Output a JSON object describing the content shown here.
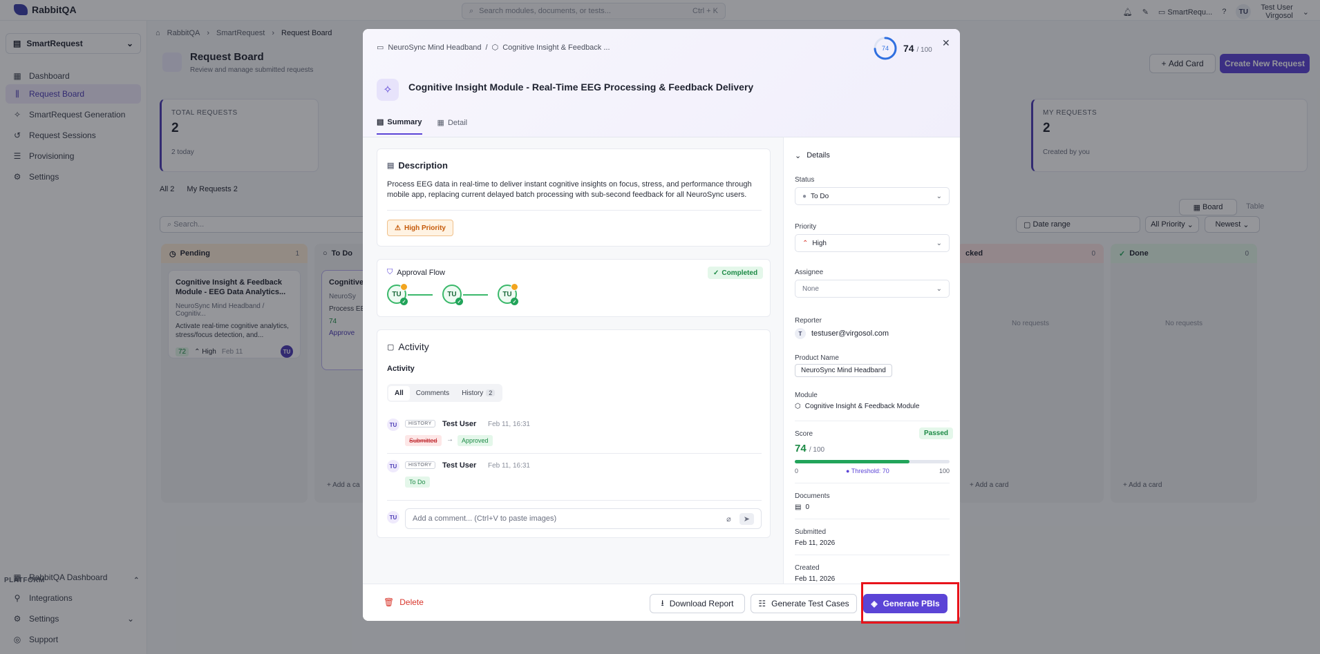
{
  "app": {
    "name": "RabbitQA"
  },
  "topbar": {
    "search_placeholder": "Search modules, documents, or tests...",
    "search_shortcut": "Ctrl + K",
    "workspace": "SmartRequ...",
    "user_initials": "TU",
    "user_name": "Test User",
    "user_org": "Virgosol"
  },
  "sidebar": {
    "workspace": "SmartRequest",
    "items": [
      {
        "label": "Dashboard",
        "icon": "grid-icon"
      },
      {
        "label": "Request Board",
        "icon": "board-icon"
      },
      {
        "label": "SmartRequest Generation",
        "icon": "sparkle-icon"
      },
      {
        "label": "Request Sessions",
        "icon": "history-icon"
      },
      {
        "label": "Provisioning",
        "icon": "sliders-icon"
      },
      {
        "label": "Settings",
        "icon": "gear-icon"
      }
    ],
    "platform_label": "PLATFORM",
    "platform_items": [
      {
        "label": "RabbitQA Dashboard"
      },
      {
        "label": "Integrations"
      },
      {
        "label": "Settings"
      },
      {
        "label": "Support"
      }
    ]
  },
  "page": {
    "breadcrumb": [
      "RabbitQA",
      "SmartRequest",
      "Request Board"
    ],
    "title": "Request Board",
    "subtitle": "Review and manage submitted requests",
    "add_card": "Add Card",
    "create_new": "Create New Request",
    "stats": [
      {
        "label": "TOTAL REQUESTS",
        "value": "2",
        "note": "2 today"
      },
      {
        "label": "MY REQUESTS",
        "value": "2",
        "note": "Created by you"
      }
    ],
    "filters": {
      "all": "All",
      "all_count": "2",
      "mine": "My Requests",
      "mine_count": "2",
      "search": "Search...",
      "date_range": "Date range",
      "priority": "All Priority",
      "sort": "Newest",
      "board": "Board",
      "table": "Table"
    },
    "columns": [
      {
        "name": "Pending",
        "count": "1"
      },
      {
        "name": "To Do",
        "count": ""
      },
      {
        "name": "cked",
        "count": "0",
        "empty": "No requests",
        "add": "Add a card"
      },
      {
        "name": "Done",
        "count": "0",
        "empty": "No requests",
        "add": "Add a card"
      }
    ],
    "card1": {
      "title": "Cognitive Insight & Feedback Module - EEG Data Analytics...",
      "path": "NeuroSync Mind Headband / Cognitiv...",
      "desc": "Activate real-time cognitive analytics, stress/focus detection, and...",
      "score": "72",
      "priority": "High",
      "date": "Feb 11",
      "avatar": "TU"
    },
    "card2": {
      "title": "Cognitive Ir Time EEG P",
      "path": "NeuroSy",
      "desc": "Process EEG instant cogr",
      "score": "74",
      "status": "Approve"
    },
    "todo_add": "Add a ca"
  },
  "modal": {
    "breadcrumb_product": "NeuroSync Mind Headband",
    "breadcrumb_module": "Cognitive Insight & Feedback ...",
    "score": 74,
    "score_max": "/ 100",
    "score_text": "74",
    "title": "Cognitive Insight Module - Real-Time EEG Processing & Feedback Delivery",
    "tabs": [
      "Summary",
      "Detail"
    ],
    "description_heading": "Description",
    "description": "Process EEG data in real-time to deliver instant cognitive insights on focus, stress, and performance through mobile app, replacing current delayed batch processing with sub-second feedback for all NeuroSync users.",
    "priority_badge": "High Priority",
    "approval_heading": "Approval Flow",
    "approval_status": "Completed",
    "approvers": [
      "TU",
      "TU",
      "TU"
    ],
    "activity_heading": "Activity",
    "activity_sub": "Activity",
    "activity_tabs": {
      "all": "All",
      "comments": "Comments",
      "history": "History",
      "history_count": "2"
    },
    "history": [
      {
        "avatar": "TU",
        "tag": "HISTORY",
        "user": "Test User",
        "time": "Feb 11, 16:31",
        "from": "Submitted",
        "to": "Approved"
      },
      {
        "avatar": "TU",
        "tag": "HISTORY",
        "user": "Test User",
        "time": "Feb 11, 16:31",
        "to": "To Do"
      }
    ],
    "comment_avatar": "TU",
    "comment_placeholder": "Add a comment... (Ctrl+V to paste images)",
    "details": {
      "heading": "Details",
      "status_label": "Status",
      "status": "To Do",
      "priority_label": "Priority",
      "priority": "High",
      "assignee_label": "Assignee",
      "assignee": "None",
      "reporter_label": "Reporter",
      "reporter_initial": "T",
      "reporter": "testuser@virgosol.com",
      "product_label": "Product Name",
      "product": "NeuroSync Mind Headband",
      "module_label": "Module",
      "module": "Cognitive Insight & Feedback Module",
      "score_label": "Score",
      "score_badge": "Passed",
      "score_value": "74",
      "score_max": "/ 100",
      "score_fraction": 0.74,
      "min": "0",
      "threshold": "Threshold: 70",
      "max": "100",
      "documents_label": "Documents",
      "documents": "0",
      "submitted_label": "Submitted",
      "submitted": "Feb 11, 2026",
      "created_label": "Created",
      "created": "Feb 11, 2026"
    },
    "footer": {
      "delete": "Delete",
      "download": "Download Report",
      "test_cases": "Generate Test Cases",
      "pbis": "Generate PBIs"
    }
  },
  "colors": {
    "accent": "#5b44d6",
    "success": "#22a45a",
    "danger": "#e8131b",
    "warning": "#c55a0a"
  }
}
